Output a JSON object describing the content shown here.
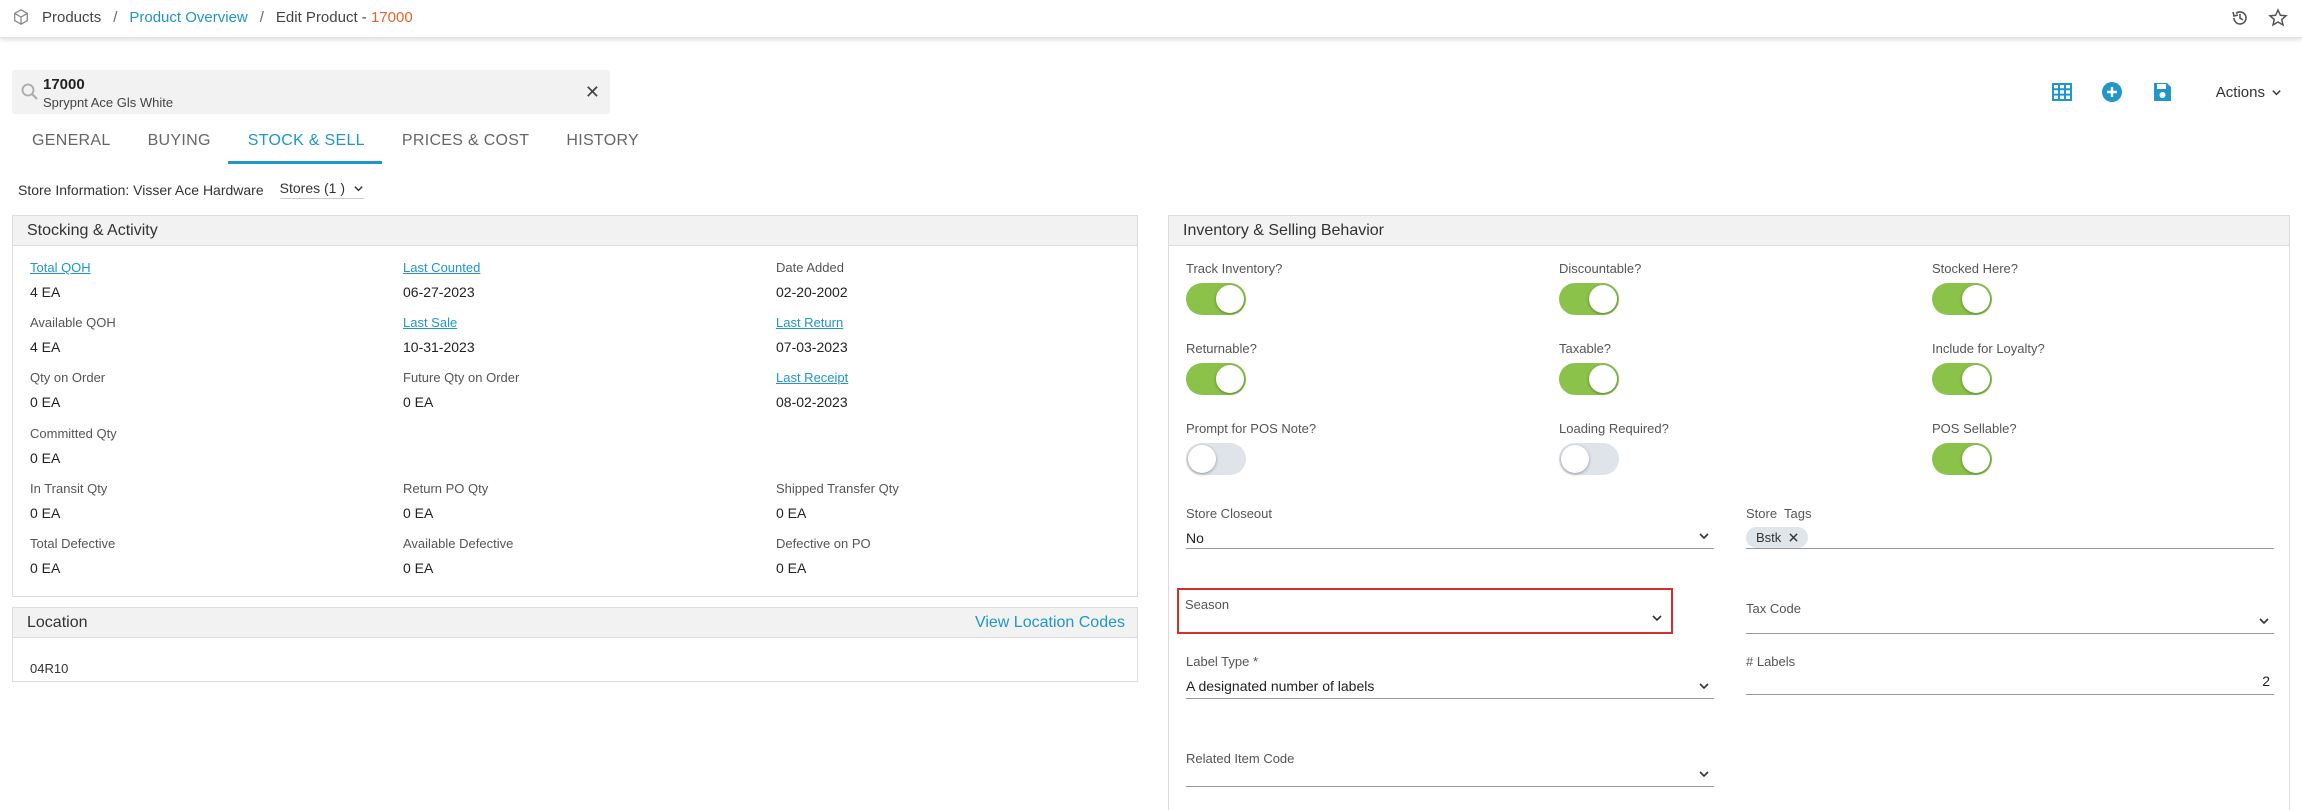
{
  "breadcrumb": {
    "root": "Products",
    "overview": "Product Overview",
    "edit_prefix": "Edit Product - ",
    "edit_code": "17000"
  },
  "search": {
    "code": "17000",
    "description": "Sprypnt Ace Gls White",
    "clear": "✕"
  },
  "toolbar": {
    "actions_label": "Actions"
  },
  "tabs": [
    {
      "label": "GENERAL"
    },
    {
      "label": "BUYING"
    },
    {
      "label": "STOCK & SELL"
    },
    {
      "label": "PRICES & COST"
    },
    {
      "label": "HISTORY"
    }
  ],
  "store": {
    "info": "Store Information: Visser Ace Hardware",
    "selector": "Stores (1 )"
  },
  "stocking": {
    "title": "Stocking & Activity",
    "cells": [
      {
        "label": "Total QOH",
        "value": "4  EA"
      },
      {
        "label": "Last Counted",
        "value": "06-27-2023"
      },
      {
        "label": "Date Added",
        "value": "02-20-2002"
      },
      {
        "label": "Available QOH",
        "value": "4  EA"
      },
      {
        "label": "Last Sale",
        "value": "10-31-2023"
      },
      {
        "label": "Last Return",
        "value": "07-03-2023"
      },
      {
        "label": "Qty on Order",
        "value": "0  EA"
      },
      {
        "label": "Future Qty on Order",
        "value": "0  EA"
      },
      {
        "label": "Last Receipt",
        "value": "08-02-2023"
      },
      {
        "label": "Committed Qty",
        "value": "0  EA"
      },
      {
        "label": "In Transit Qty",
        "value": "0  EA"
      },
      {
        "label": "Return PO Qty",
        "value": "0  EA"
      },
      {
        "label": "Shipped Transfer Qty",
        "value": "0  EA"
      },
      {
        "label": "Total Defective",
        "value": "0  EA"
      },
      {
        "label": "Available Defective",
        "value": "0  EA"
      },
      {
        "label": "Defective on PO",
        "value": "0  EA"
      }
    ]
  },
  "location": {
    "title": "Location",
    "view_codes": "View Location Codes",
    "value": "04R10"
  },
  "inventory": {
    "title": "Inventory & Selling Behavior",
    "toggles": [
      {
        "label": "Track Inventory?",
        "on": true
      },
      {
        "label": "Discountable?",
        "on": true
      },
      {
        "label": "Stocked Here?",
        "on": true
      },
      {
        "label": "Returnable?",
        "on": true
      },
      {
        "label": "Taxable?",
        "on": true
      },
      {
        "label": "Include for Loyalty?",
        "on": true
      },
      {
        "label": "Prompt for POS Note?",
        "on": false
      },
      {
        "label": "Loading Required?",
        "on": false
      },
      {
        "label": "POS Sellable?",
        "on": true
      }
    ],
    "fields": {
      "store_closeout": {
        "label": "Store Closeout",
        "value": "No"
      },
      "store_tags": {
        "label": "Store  Tags",
        "tag": "Bstk"
      },
      "season": {
        "label": "Season",
        "value": ""
      },
      "tax_code": {
        "label": "Tax Code",
        "value": ""
      },
      "label_type": {
        "label": "Label Type *",
        "value": "A designated number of labels"
      },
      "num_labels": {
        "label": "# Labels",
        "value": "2"
      },
      "related_item": {
        "label": "Related Item Code",
        "value": ""
      }
    }
  },
  "colors": {
    "accent": "#2196c9",
    "orange": "#e8632b",
    "toggle_on": "#8bc34a",
    "highlight": "#d32f2f"
  }
}
